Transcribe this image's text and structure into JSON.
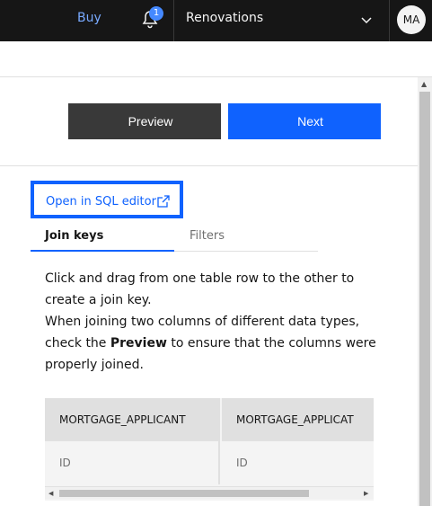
{
  "header": {
    "buy_label": "Buy",
    "notification_count": "1",
    "project_name": "Renovations",
    "avatar_initials": "MA",
    "icons": [
      "notification-bell-icon",
      "chevron-down-icon"
    ]
  },
  "actions": {
    "preview_label": "Preview",
    "next_label": "Next"
  },
  "sql_link_label": "Open in SQL editor",
  "tabs": [
    {
      "label": "Join keys",
      "selected": true
    },
    {
      "label": "Filters",
      "selected": false
    }
  ],
  "description": {
    "line1": "Click and drag from one table row to the other to create a join key.",
    "line2_before": "When joining two columns of different data types, check the ",
    "line2_bold": "Preview",
    "line2_after": " to ensure that the columns were properly joined."
  },
  "table": {
    "columns": [
      "MORTGAGE_APPLICANT",
      "MORTGAGE_APPLICAT"
    ],
    "rows": [
      [
        "ID",
        "ID"
      ]
    ]
  },
  "colors": {
    "accent": "#0f62fe",
    "topbar": "#161616",
    "secondary_button": "#393939"
  }
}
